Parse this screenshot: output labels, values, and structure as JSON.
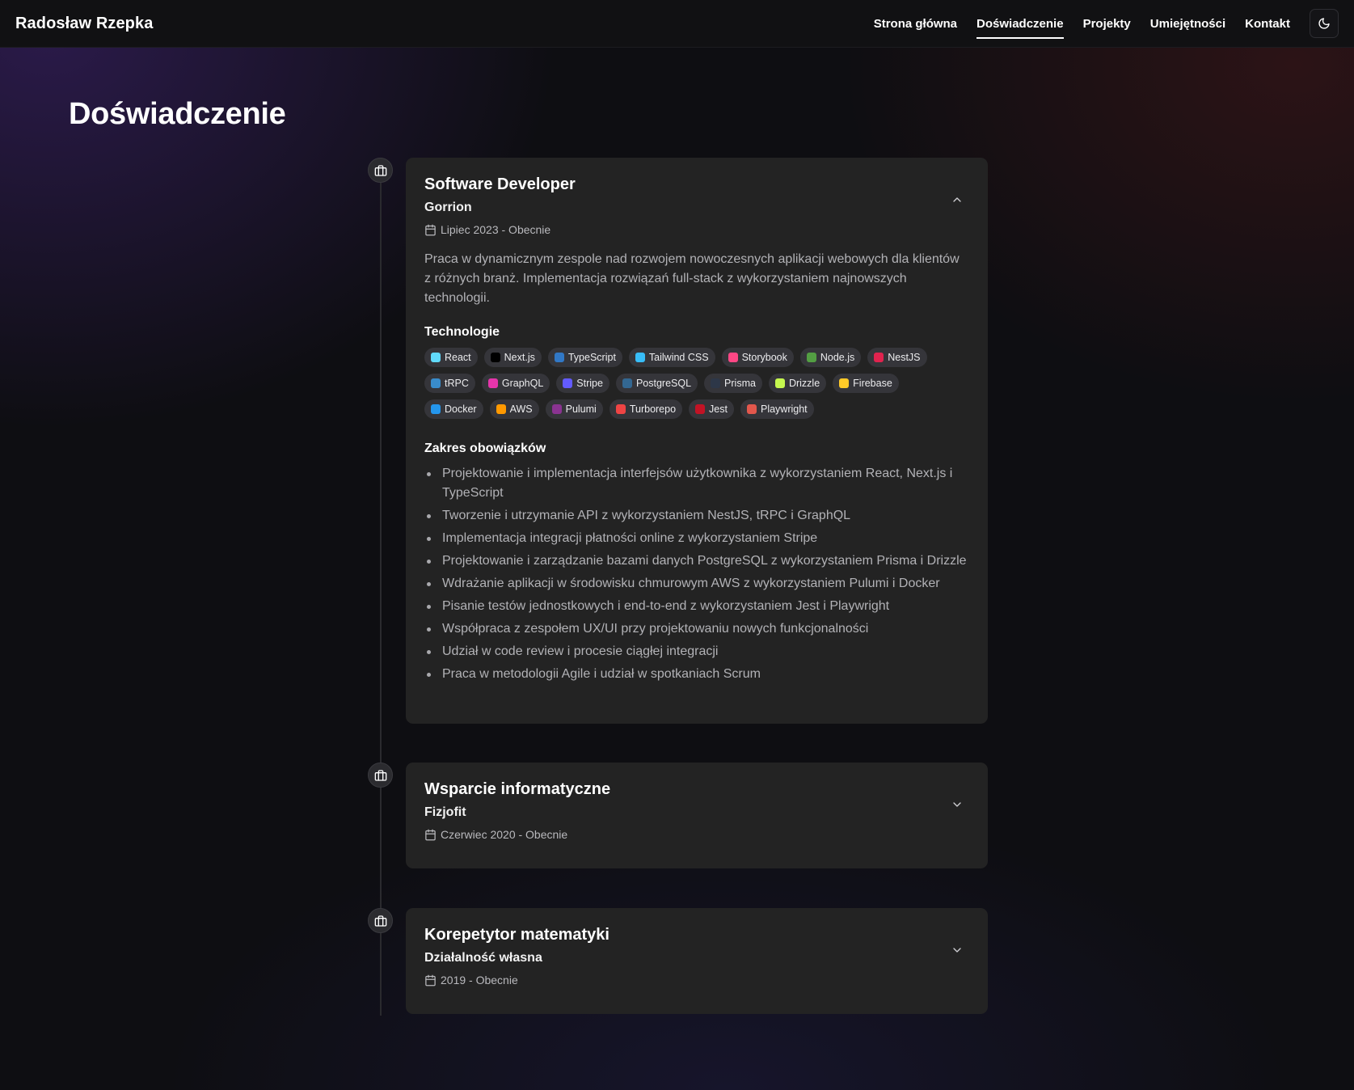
{
  "header": {
    "brand": "Radosław Rzepka",
    "nav": [
      {
        "label": "Strona główna",
        "active": false
      },
      {
        "label": "Doświadczenie",
        "active": true
      },
      {
        "label": "Projekty",
        "active": false
      },
      {
        "label": "Umiejętności",
        "active": false
      },
      {
        "label": "Kontakt",
        "active": false
      }
    ],
    "theme_toggle_icon": "moon-icon"
  },
  "page": {
    "title": "Doświadczenie"
  },
  "experience": [
    {
      "title": "Software Developer",
      "company": "Gorrion",
      "date": "Lipiec 2023 - Obecnie",
      "expanded": true,
      "description": "Praca w dynamicznym zespole nad rozwojem nowoczesnych aplikacji webowych dla klientów z różnych branż. Implementacja rozwiązań full-stack z wykorzystaniem najnowszych technologii.",
      "tech_heading": "Technologie",
      "technologies": [
        {
          "label": "React",
          "color": "#61dafb",
          "icon": "react-icon"
        },
        {
          "label": "Next.js",
          "color": "#000000",
          "icon": "nextjs-icon"
        },
        {
          "label": "TypeScript",
          "color": "#3178c6",
          "icon": "typescript-icon"
        },
        {
          "label": "Tailwind CSS",
          "color": "#38bdf8",
          "icon": "tailwind-icon"
        },
        {
          "label": "Storybook",
          "color": "#ff4785",
          "icon": "storybook-icon"
        },
        {
          "label": "Node.js",
          "color": "#539e43",
          "icon": "nodejs-icon"
        },
        {
          "label": "NestJS",
          "color": "#e0234e",
          "icon": "nestjs-icon"
        },
        {
          "label": "tRPC",
          "color": "#398ccb",
          "icon": "trpc-icon"
        },
        {
          "label": "GraphQL",
          "color": "#e535ab",
          "icon": "graphql-icon"
        },
        {
          "label": "Stripe",
          "color": "#635bff",
          "icon": "stripe-icon"
        },
        {
          "label": "PostgreSQL",
          "color": "#336791",
          "icon": "postgresql-icon"
        },
        {
          "label": "Prisma",
          "color": "#2d3748",
          "icon": "prisma-icon"
        },
        {
          "label": "Drizzle",
          "color": "#c5f74f",
          "icon": "drizzle-icon"
        },
        {
          "label": "Firebase",
          "color": "#ffca28",
          "icon": "firebase-icon"
        },
        {
          "label": "Docker",
          "color": "#2496ed",
          "icon": "docker-icon"
        },
        {
          "label": "AWS",
          "color": "#ff9900",
          "icon": "aws-icon"
        },
        {
          "label": "Pulumi",
          "color": "#8a3391",
          "icon": "pulumi-icon"
        },
        {
          "label": "Turborepo",
          "color": "#ef4444",
          "icon": "turborepo-icon"
        },
        {
          "label": "Jest",
          "color": "#c21325",
          "icon": "jest-icon"
        },
        {
          "label": "Playwright",
          "color": "#e2574c",
          "icon": "playwright-icon"
        }
      ],
      "duties_heading": "Zakres obowiązków",
      "duties": [
        "Projektowanie i implementacja interfejsów użytkownika z wykorzystaniem React, Next.js i TypeScript",
        "Tworzenie i utrzymanie API z wykorzystaniem NestJS, tRPC i GraphQL",
        "Implementacja integracji płatności online z wykorzystaniem Stripe",
        "Projektowanie i zarządzanie bazami danych PostgreSQL z wykorzystaniem Prisma i Drizzle",
        "Wdrażanie aplikacji w środowisku chmurowym AWS z wykorzystaniem Pulumi i Docker",
        "Pisanie testów jednostkowych i end-to-end z wykorzystaniem Jest i Playwright",
        "Współpraca z zespołem UX/UI przy projektowaniu nowych funkcjonalności",
        "Udział w code review i procesie ciągłej integracji",
        "Praca w metodologii Agile i udział w spotkaniach Scrum"
      ]
    },
    {
      "title": "Wsparcie informatyczne",
      "company": "Fizjofit",
      "date": "Czerwiec 2020 - Obecnie",
      "expanded": false
    },
    {
      "title": "Korepetytor matematyki",
      "company": "Działalność własna",
      "date": "2019 - Obecnie",
      "expanded": false
    }
  ]
}
